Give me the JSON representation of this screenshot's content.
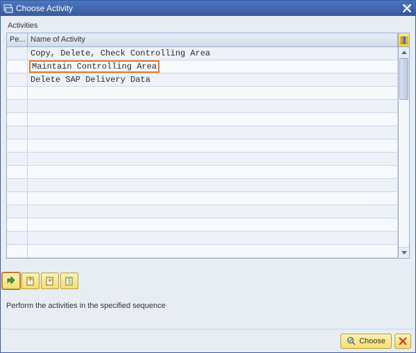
{
  "window": {
    "title": "Choose Activity"
  },
  "section": {
    "header": "Activities"
  },
  "table": {
    "columns": {
      "pe": "Pe...",
      "name": "Name of Activity"
    },
    "rows": [
      {
        "pe": "",
        "name": "Copy, Delete, Check Controlling Area",
        "highlighted": false
      },
      {
        "pe": "",
        "name": "Maintain Controlling Area",
        "highlighted": true
      },
      {
        "pe": "",
        "name": "Delete SAP Delivery Data",
        "highlighted": false
      },
      {
        "pe": "",
        "name": ""
      },
      {
        "pe": "",
        "name": ""
      },
      {
        "pe": "",
        "name": ""
      },
      {
        "pe": "",
        "name": ""
      },
      {
        "pe": "",
        "name": ""
      },
      {
        "pe": "",
        "name": ""
      },
      {
        "pe": "",
        "name": ""
      },
      {
        "pe": "",
        "name": ""
      },
      {
        "pe": "",
        "name": ""
      },
      {
        "pe": "",
        "name": ""
      },
      {
        "pe": "",
        "name": ""
      },
      {
        "pe": "",
        "name": ""
      },
      {
        "pe": "",
        "name": ""
      }
    ]
  },
  "instruction": "Perform the activities in the specified sequence",
  "footer": {
    "choose": "Choose"
  }
}
